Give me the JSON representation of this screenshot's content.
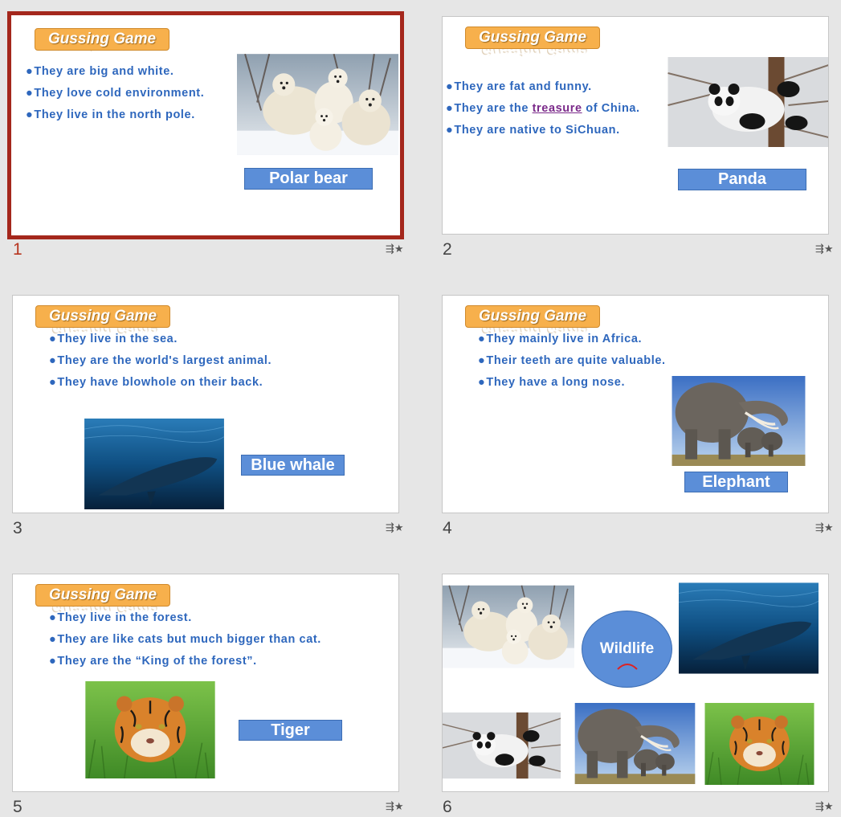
{
  "title_text": "Gussing Game",
  "bullet": "●",
  "slides": [
    {
      "num": "1",
      "label": "Polar bear",
      "bullets": [
        "They are big and white.",
        "They love cold environment.",
        "They live in the north pole."
      ]
    },
    {
      "num": "2",
      "label": "Panda",
      "bullets": [
        "They are fat and funny.",
        "They are native to SiChuan."
      ],
      "b2_pre": "They are the ",
      "b2_hl": "treasure",
      "b2_post": " of China."
    },
    {
      "num": "3",
      "label": "Blue whale",
      "bullets": [
        "They live in the sea.",
        "They are the world's largest animal.",
        "They have blowhole on their back."
      ]
    },
    {
      "num": "4",
      "label": "Elephant",
      "bullets": [
        "They mainly live in Africa.",
        "Their teeth are quite valuable.",
        "They have a long nose."
      ]
    },
    {
      "num": "5",
      "label": "Tiger",
      "bullets": [
        "They live in the forest.",
        "They are like cats but much bigger than cat.",
        "They are the “King of the forest”."
      ]
    },
    {
      "num": "6",
      "center_text": "Wildlife"
    }
  ],
  "star_icon": "☆",
  "colors": {
    "accent_selected": "#a4271c",
    "bullet_text": "#2e67bd",
    "label_bg": "#5b8ed8",
    "title_bg": "#f7b04c"
  }
}
